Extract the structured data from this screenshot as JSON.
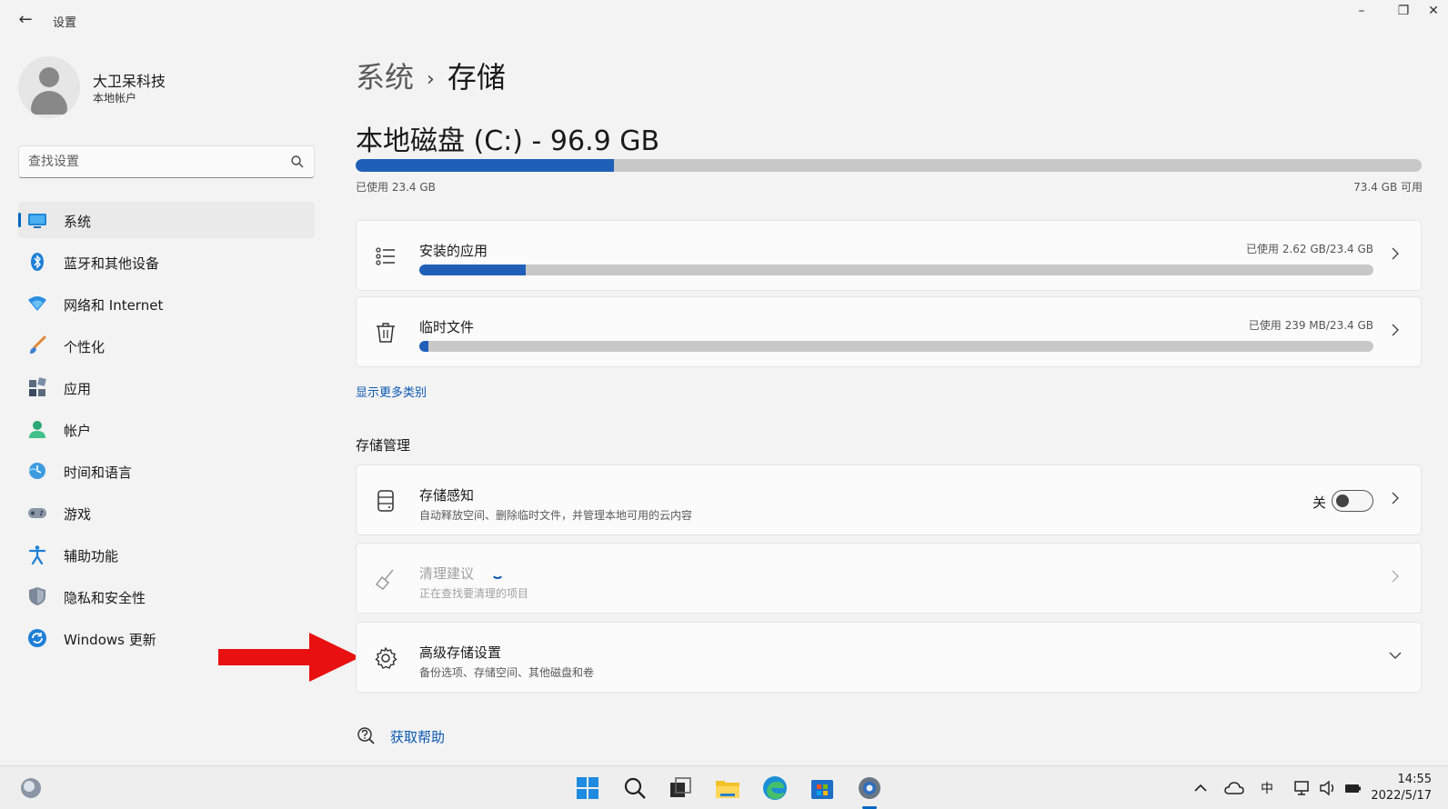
{
  "window": {
    "title": "设置",
    "back_icon": "back-arrow-icon",
    "controls": [
      "minimize-icon",
      "restore-icon",
      "close-icon"
    ]
  },
  "profile": {
    "name": "大卫呆科技",
    "account_type": "本地帐户"
  },
  "search": {
    "placeholder": "查找设置"
  },
  "sidebar": {
    "items": [
      {
        "label": "系统",
        "icon": "system-icon",
        "active": true
      },
      {
        "label": "蓝牙和其他设备",
        "icon": "bluetooth-icon"
      },
      {
        "label": "网络和 Internet",
        "icon": "network-icon"
      },
      {
        "label": "个性化",
        "icon": "personalization-brush-icon"
      },
      {
        "label": "应用",
        "icon": "apps-icon"
      },
      {
        "label": "帐户",
        "icon": "account-icon"
      },
      {
        "label": "时间和语言",
        "icon": "time-language-icon"
      },
      {
        "label": "游戏",
        "icon": "gaming-icon"
      },
      {
        "label": "辅助功能",
        "icon": "accessibility-icon"
      },
      {
        "label": "隐私和安全性",
        "icon": "privacy-shield-icon"
      },
      {
        "label": "Windows 更新",
        "icon": "windows-update-icon"
      }
    ]
  },
  "breadcrumb": {
    "parent": "系统",
    "separator": "›",
    "current": "存储"
  },
  "disk": {
    "title": "本地磁盘 (C:) - 96.9 GB",
    "used_label": "已使用 23.4 GB",
    "free_label": "73.4 GB 可用",
    "used_fraction": 0.242
  },
  "categories": [
    {
      "title": "安装的应用",
      "usage": "已使用 2.62 GB/23.4 GB",
      "fraction": 0.112,
      "icon": "list-icon"
    },
    {
      "title": "临时文件",
      "usage": "已使用 239 MB/23.4 GB",
      "fraction": 0.01,
      "icon": "trash-icon"
    }
  ],
  "show_more_link": "显示更多类别",
  "storage_management": {
    "section_title": "存储管理",
    "storage_sense": {
      "title": "存储感知",
      "description": "自动释放空间、删除临时文件，并管理本地可用的云内容",
      "toggle_label": "关",
      "toggle_on": false,
      "icon": "storage-drive-icon"
    },
    "cleanup": {
      "title": "清理建议",
      "description": "正在查找要清理的项目",
      "icon": "broom-icon",
      "disabled": true
    },
    "advanced": {
      "title": "高级存储设置",
      "description": "备份选项、存储空间、其他磁盘和卷",
      "icon": "gear-icon"
    }
  },
  "help": {
    "label": "获取帮助",
    "icon": "help-icon"
  },
  "annotation": {
    "arrow_color": "#e81010"
  },
  "taskbar": {
    "apps": [
      "windows-start-icon",
      "search-icon",
      "task-view-icon",
      "file-explorer-icon",
      "edge-browser-icon",
      "store-icon",
      "settings-icon"
    ],
    "ime": "中",
    "time": "14:55",
    "date": "2022/5/17"
  },
  "colors": {
    "accent": "#0067c0",
    "bar_fill": "#1f5fb8",
    "bar_track": "#c8c8c8",
    "link": "#0a57b0"
  }
}
